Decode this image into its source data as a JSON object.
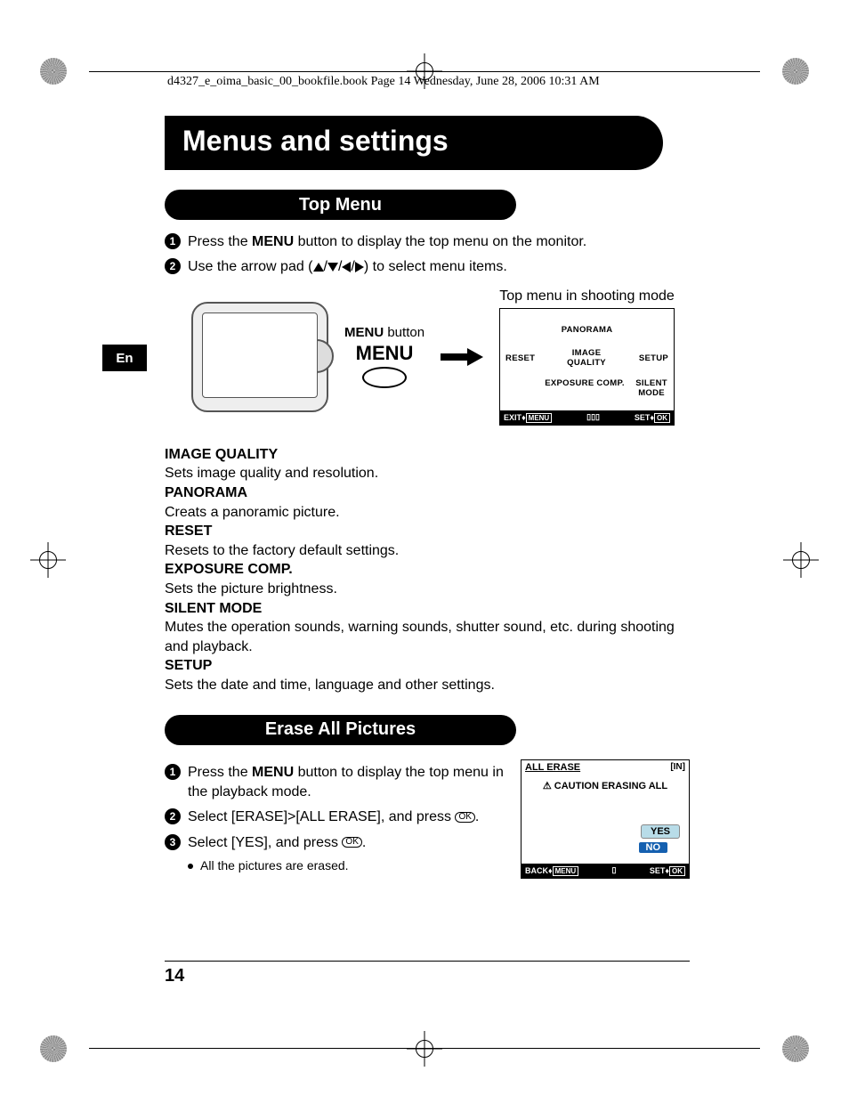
{
  "header_line": "d4327_e_oima_basic_00_bookfile.book  Page 14  Wednesday, June 28, 2006  10:31 AM",
  "lang_tag": "En",
  "chapter_title": "Menus and settings",
  "section1": {
    "title": "Top Menu",
    "step1_a": "Press the ",
    "step1_b": "MENU",
    "step1_c": " button to display the top menu on the monitor.",
    "step2": "Use the arrow pad (",
    "step2_end": ") to select menu items.",
    "menu_btn_label_a": "MENU",
    "menu_btn_label_b": " button",
    "menu_word": "MENU",
    "top_menu_caption": "Top menu in shooting mode",
    "lcd": {
      "panorama": "PANORAMA",
      "reset": "RESET",
      "image_quality": "IMAGE QUALITY",
      "setup": "SETUP",
      "exposure_comp": "EXPOSURE COMP.",
      "silent_mode": "SILENT MODE",
      "exit": "EXIT",
      "menu": "MENU",
      "set": "SET",
      "ok": "OK"
    }
  },
  "definitions": [
    {
      "head": "IMAGE QUALITY",
      "body": "Sets image quality and resolution."
    },
    {
      "head": "PANORAMA",
      "body": "Creats a panoramic picture."
    },
    {
      "head": "RESET",
      "body": "Resets to the factory default settings."
    },
    {
      "head": "EXPOSURE COMP.",
      "body": "Sets the picture brightness."
    },
    {
      "head": "SILENT MODE",
      "body": "Mutes the operation sounds, warning sounds, shutter sound, etc. during shooting and playback."
    },
    {
      "head": "SETUP",
      "body": "Sets the date and time, language and other settings."
    }
  ],
  "section2": {
    "title": "Erase All Pictures",
    "step1_a": "Press the ",
    "step1_b": "MENU",
    "step1_c": " button to display the top menu in the playback mode.",
    "step2": "Select [ERASE]>[ALL ERASE], and press ",
    "step3": "Select [YES], and press ",
    "bullet": "All the pictures are erased.",
    "ok_glyph": "OK",
    "lcd": {
      "title": "ALL ERASE",
      "in": "[IN]",
      "warn": "CAUTION ERASING ALL",
      "yes": "YES",
      "no": "NO",
      "back": "BACK",
      "menu": "MENU",
      "set": "SET",
      "ok": "OK"
    }
  },
  "page_number": "14"
}
